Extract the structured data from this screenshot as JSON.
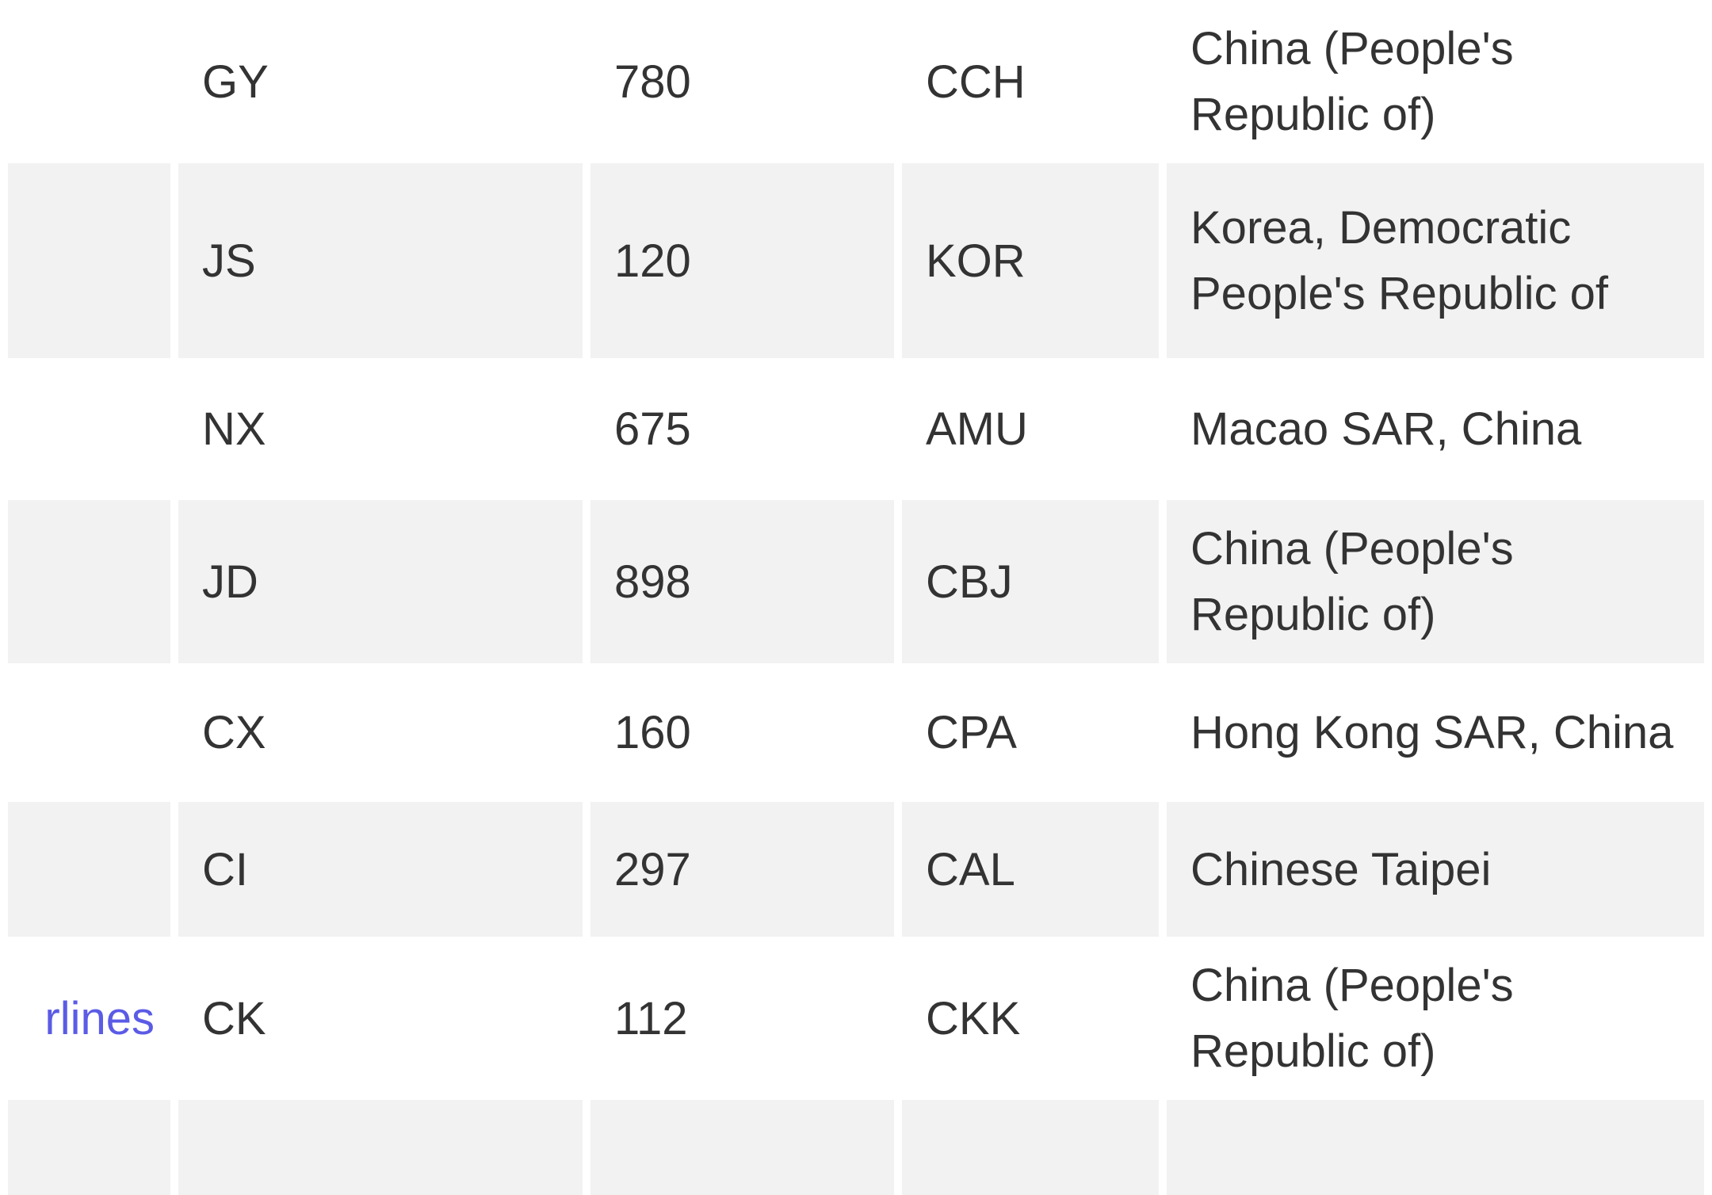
{
  "table": {
    "rows": [
      {
        "name": "",
        "iata": "GY",
        "code": "780",
        "icao": "CCH",
        "country": "China (People's Republic of)"
      },
      {
        "name": "",
        "iata": "JS",
        "code": "120",
        "icao": "KOR",
        "country": "Korea, Democratic People's Republic of"
      },
      {
        "name": "",
        "iata": "NX",
        "code": "675",
        "icao": "AMU",
        "country": "Macao SAR, China"
      },
      {
        "name": "",
        "iata": "JD",
        "code": "898",
        "icao": "CBJ",
        "country": "China (People's Republic of)"
      },
      {
        "name": "",
        "iata": "CX",
        "code": "160",
        "icao": "CPA",
        "country": "Hong Kong SAR, China"
      },
      {
        "name": "",
        "iata": "CI",
        "code": "297",
        "icao": "CAL",
        "country": "Chinese Taipei"
      },
      {
        "name": "rlines",
        "iata": "CK",
        "code": "112",
        "icao": "CKK",
        "country": "China (People's Republic of)"
      },
      {
        "name": "",
        "iata": "",
        "code": "",
        "icao": "",
        "country": ""
      }
    ]
  },
  "colors": {
    "link": "#5b5be6",
    "stripe": "#f2f2f2",
    "text": "#333333"
  }
}
